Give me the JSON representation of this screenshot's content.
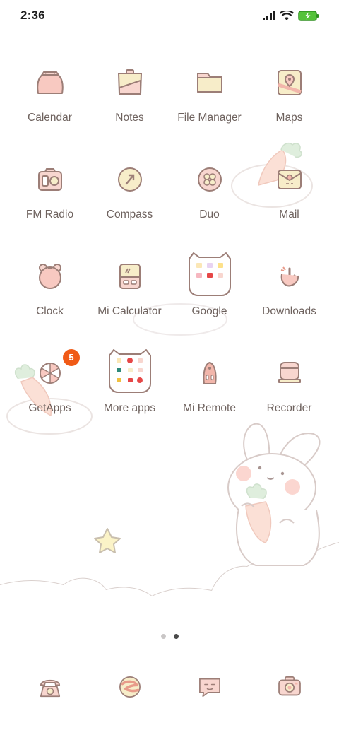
{
  "status_bar": {
    "time": "2:36"
  },
  "apps": [
    [
      {
        "id": "calendar",
        "label": "Calendar"
      },
      {
        "id": "notes",
        "label": "Notes"
      },
      {
        "id": "file-manager",
        "label": "File Manager"
      },
      {
        "id": "maps",
        "label": "Maps"
      }
    ],
    [
      {
        "id": "fm-radio",
        "label": "FM Radio"
      },
      {
        "id": "compass",
        "label": "Compass"
      },
      {
        "id": "duo",
        "label": "Duo"
      },
      {
        "id": "mail",
        "label": "Mail"
      }
    ],
    [
      {
        "id": "clock",
        "label": "Clock"
      },
      {
        "id": "mi-calculator",
        "label": "Mi Calculator"
      },
      {
        "id": "google",
        "label": "Google"
      },
      {
        "id": "downloads",
        "label": "Downloads"
      }
    ],
    [
      {
        "id": "getapps",
        "label": "GetApps",
        "badge": "5"
      },
      {
        "id": "more-apps",
        "label": "More apps"
      },
      {
        "id": "mi-remote",
        "label": "Mi Remote"
      },
      {
        "id": "recorder",
        "label": "Recorder"
      }
    ]
  ],
  "pager": {
    "pages": 2,
    "active": 2
  },
  "dock": [
    "phone-icon",
    "browser-icon",
    "messages-icon",
    "camera-icon"
  ],
  "colors": {
    "badge": "#f05a16",
    "icon_fill": "#f8d6cf",
    "icon_stroke": "#9c7e77",
    "cream": "#f7edc9"
  }
}
